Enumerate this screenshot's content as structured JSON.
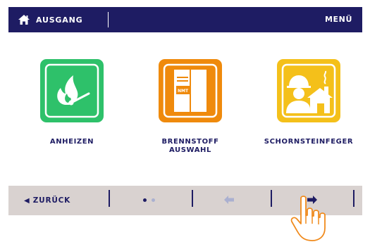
{
  "header": {
    "home_label": "AUSGANG",
    "menu_label": "MENÜ"
  },
  "tiles": [
    {
      "label": "ANHEIZEN",
      "color": "#2ec16a",
      "icon": "match-flame-icon"
    },
    {
      "label": "BRENNSTOFF\nAUSWAHL",
      "color": "#ef8a0c",
      "icon": "fuel-bag-icon",
      "badge": "NMT"
    },
    {
      "label": "SCHORNSTEINFEGER",
      "color": "#f4c01a",
      "icon": "chimney-sweep-icon"
    }
  ],
  "footer": {
    "back_label": "ZURÜCK",
    "page_indicator": {
      "current": 1,
      "total": 2
    },
    "colors": {
      "active_dot": "#1e1c63",
      "inactive": "#aab0d0",
      "arrow_next": "#1e1c63"
    }
  },
  "cursor": "hand-pointer-icon"
}
